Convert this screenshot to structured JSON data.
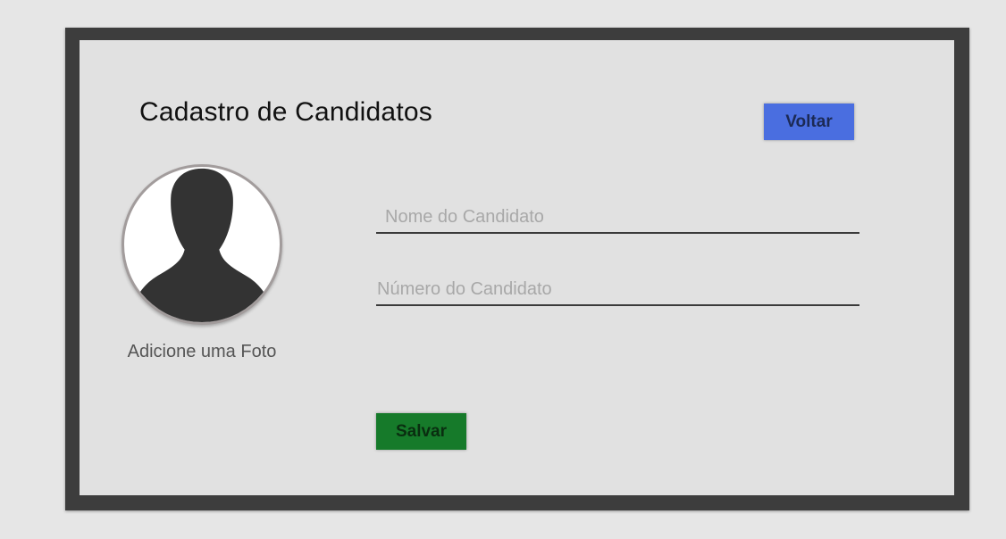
{
  "form": {
    "title": "Cadastro de Candidatos",
    "back_label": "Voltar",
    "photo_label": "Adicione uma Foto",
    "name_field": {
      "value": "",
      "placeholder": "Nome do Candidato"
    },
    "number_field": {
      "value": "",
      "placeholder": "Número do Candidato"
    },
    "save_label": "Salvar"
  },
  "icons": {
    "avatar": "person-silhouette-icon"
  },
  "colors": {
    "back_button": "#4a6ee0",
    "save_button": "#167a2a",
    "frame": "#3d3d3d",
    "panel": "#e1e1e1"
  }
}
